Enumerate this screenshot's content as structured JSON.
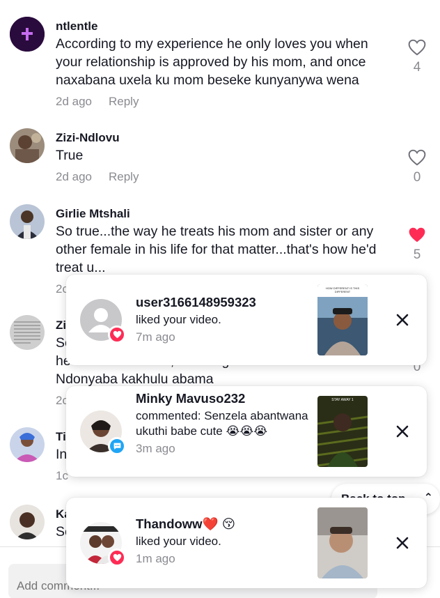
{
  "comments": [
    {
      "user": "ntlentle",
      "text": "According to my experience he only loves you when your relationship is approved by his mom, and once naxabana uxela ku mom beseke kunyanywa wena",
      "time": "2d ago",
      "reply": "Reply",
      "likes": "4",
      "liked": false,
      "avatar_color": "#2a0b3d"
    },
    {
      "user": "Zizi-Ndlovu",
      "text": "True",
      "time": "2d ago",
      "reply": "Reply",
      "likes": "0",
      "liked": false,
      "avatar_color": "#7b6656"
    },
    {
      "user": "Girlie Mtshali",
      "text": "So true...the way he treats his mom and sister or any other female in his life for that matter...that's how he'd treat u...",
      "time": "2c",
      "likes": "5",
      "liked": true,
      "avatar_color": "#3d4a5e"
    },
    {
      "user": "Zi",
      "text_lines": [
        "Sc",
        "he loves his sisters, his daughter's and mo.",
        "Ndonyaba kakhulu abama"
      ],
      "time": "2c",
      "likes": "0",
      "avatar_color": "#a8a8a8"
    },
    {
      "user": "Ti",
      "text": "In",
      "time": "1c",
      "avatar_color": "#9aa6c4"
    },
    {
      "user": "Ka",
      "text": "Sc",
      "avatar_color": "#5a4334"
    }
  ],
  "notifications": [
    {
      "user": "user3166148959323",
      "text": "liked your video.",
      "time": "7m ago",
      "badge": "heart-badge",
      "badge_color": "#fe2c55",
      "thumb_caption": "HOW DIFFERENT IS THIS DIFFERENT"
    },
    {
      "user": "Minky Mavuso232",
      "text": "commented: Senzela abantwana ukuthi babe cute 😭😭😭",
      "time": "3m ago",
      "badge": "comment-badge",
      "badge_color": "#20a5f5",
      "thumb_caption": "STAY AWAY 1"
    },
    {
      "user": "Thandoww❤️ 😚",
      "text": "liked your video.",
      "time": "1m ago",
      "badge": "heart-badge",
      "badge_color": "#fe2c55",
      "thumb_caption": ""
    }
  ],
  "back_to_top": "Back to top",
  "footer": {
    "add_comment_placeholder": "Add comment..."
  },
  "colors": {
    "like_red": "#fe2c55",
    "muted": "#8a8b91",
    "text": "#161823"
  }
}
